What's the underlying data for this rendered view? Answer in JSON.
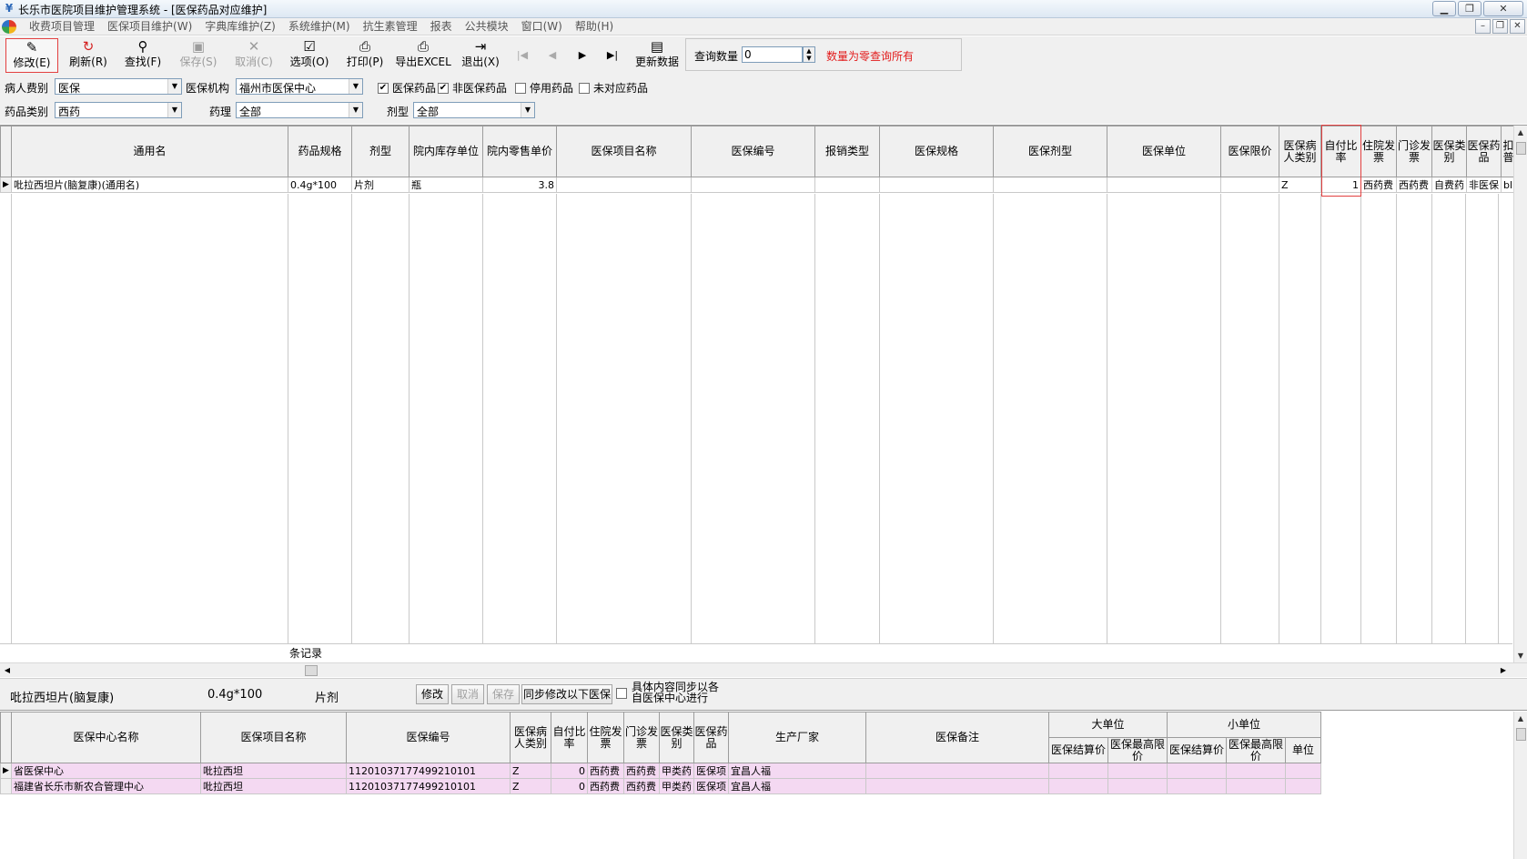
{
  "window": {
    "title": "长乐市医院项目维护管理系统 - [医保药品对应维护]",
    "controls": [
      "▁",
      "❐",
      "✕"
    ]
  },
  "menu": {
    "items": [
      "收费项目管理",
      "医保项目维护(W)",
      "字典库维护(Z)",
      "系统维护(M)",
      "抗生素管理",
      "报表",
      "公共模块",
      "窗口(W)",
      "帮助(H)"
    ],
    "mdi_controls": [
      "–",
      "❐",
      "✕"
    ]
  },
  "toolbar": {
    "modify": "修改(E)",
    "refresh": "刷新(R)",
    "find": "查找(F)",
    "save": "保存(S)",
    "cancel": "取消(C)",
    "options": "选项(O)",
    "print": "打印(P)",
    "export": "导出EXCEL",
    "exit": "退出(X)",
    "update": "更新数据",
    "query_label": "查询数量",
    "query_value": "0",
    "query_hint": "数量为零查询所有"
  },
  "filters": {
    "patient_type_label": "病人费别",
    "patient_type_value": "医保",
    "org_label": "医保机构",
    "org_value": "福州市医保中心",
    "chk_insured": "医保药品",
    "chk_insured_checked": true,
    "chk_noninsured": "非医保药品",
    "chk_noninsured_checked": true,
    "chk_disabled": "停用药品",
    "chk_disabled_checked": false,
    "chk_unmatched": "未对应药品",
    "chk_unmatched_checked": false,
    "drug_cat_label": "药品类别",
    "drug_cat_value": "西药",
    "pharm_label": "药理",
    "pharm_value": "全部",
    "form_label": "剂型",
    "form_value": "全部"
  },
  "main_grid": {
    "headers": [
      "通用名",
      "药品规格",
      "剂型",
      "院内库存单位",
      "院内零售单价",
      "医保项目名称",
      "医保编号",
      "报销类型",
      "医保规格",
      "医保剂型",
      "医保单位",
      "医保限价",
      "医保病人类别",
      "自付比率",
      "住院发票",
      "门诊发票",
      "医保类别",
      "医保药品",
      "扣普"
    ],
    "rows": [
      [
        "吡拉西坦片(脑复康)(通用名)",
        "0.4g*100",
        "片剂",
        "瓶",
        "3.8",
        "",
        "",
        "",
        "",
        "",
        "",
        "",
        "Z",
        "1",
        "西药费",
        "西药费",
        "自费药",
        "非医保",
        "bl"
      ]
    ],
    "footer": "条记录"
  },
  "detail": {
    "name": "吡拉西坦片(脑复康)",
    "spec": "0.4g*100",
    "form": "片剂",
    "btn_modify": "修改",
    "btn_cancel": "取消",
    "btn_save": "保存",
    "btn_sync": "同步修改以下医保",
    "sync_text": "具体内容同步以各自医保中心进行"
  },
  "lower_grid": {
    "headers": [
      "医保中心名称",
      "医保项目名称",
      "医保编号",
      "医保病人类别",
      "自付比率",
      "住院发票",
      "门诊发票",
      "医保类别",
      "医保药品",
      "生产厂家",
      "医保备注"
    ],
    "group_big": "大单位",
    "group_small": "小单位",
    "sub_headers": [
      "医保结算价",
      "医保最高限价",
      "医保结算价",
      "医保最高限价",
      "单位"
    ],
    "rows": [
      [
        "省医保中心",
        "吡拉西坦",
        "11201037177499210101",
        "Z",
        "0",
        "西药费",
        "西药费",
        "甲类药",
        "医保项",
        "宜昌人福",
        "",
        "",
        "",
        "",
        "",
        ""
      ],
      [
        "福建省长乐市新农合管理中心",
        "吡拉西坦",
        "11201037177499210101",
        "Z",
        "0",
        "西药费",
        "西药费",
        "甲类药",
        "医保项",
        "宜昌人福",
        "",
        "",
        "",
        "",
        "",
        ""
      ]
    ]
  }
}
